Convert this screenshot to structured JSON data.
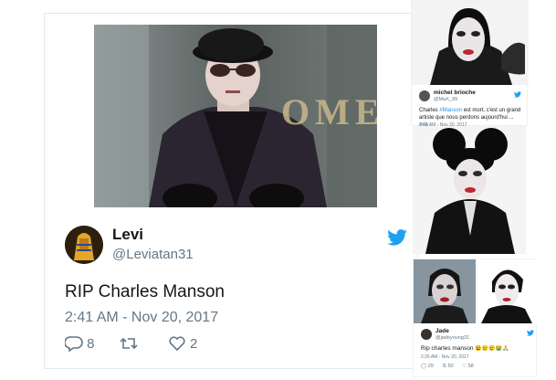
{
  "main_tweet": {
    "name": "Levi",
    "handle": "@Leviatan31",
    "text": "RIP Charles Manson",
    "timestamp": "2:41 AM - Nov 20, 2017",
    "reply_count": "8",
    "like_count": "2",
    "photo_backdrop_text": "OMES"
  },
  "side_tweet_1": {
    "name": "michel brioche",
    "handle": "@MaX_99",
    "text_before": "Charles ",
    "text_link": "#Manson",
    "text_after": " est mort, c'est un grand artiste que nous perdons aujourd'hui ... ",
    "text_tag": "#rip",
    "timestamp_partial": "2:41 AM - Nov 20, 2017"
  },
  "side_tweet_2": {
    "name": "Jade",
    "handle": "@jadeyoung31",
    "text": "Rip charles manson",
    "emojis": "😫😢😢😭🙏",
    "timestamp": "2:26 AM - Nov 20, 2017",
    "reply_count": "29",
    "retweet_count": "50",
    "like_count": "58"
  },
  "colors": {
    "twitter_blue": "#1da1f2",
    "text": "#14171a",
    "muted": "#657786",
    "border": "#e1e8ed"
  }
}
